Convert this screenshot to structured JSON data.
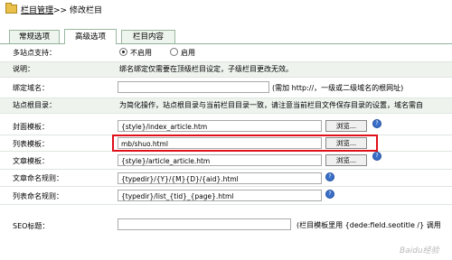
{
  "breadcrumb": {
    "parent": "栏目管理",
    "separator": ">>",
    "current": "修改栏目"
  },
  "tabs": [
    {
      "label": "常规选项"
    },
    {
      "label": "高级选项"
    },
    {
      "label": "栏目内容"
    }
  ],
  "fields": {
    "multisite": {
      "label": "多站点支持：",
      "option_no": "不启用",
      "option_yes": "启用",
      "selected": "不启用"
    },
    "info": {
      "label": "说明：",
      "text": "绑名绑定仅需要在顶级栏目设定，子级栏目更改无效。"
    },
    "domain": {
      "label": "绑定域名：",
      "value": "",
      "note": "(需加 http://，一级或二级域名的根网址)"
    },
    "site_root": {
      "label": "站点根目录：",
      "note": "为简化操作，站点根目录与当前栏目目录一致，请注意当前栏目文件保存目录的设置，域名需自"
    },
    "cover_template": {
      "label": "封面模板：",
      "value": "{style}/index_article.htm",
      "button": "浏览..."
    },
    "list_template": {
      "label": "列表模板：",
      "value": "mb/shuo.html",
      "button": "浏览..."
    },
    "article_template": {
      "label": "文章模板：",
      "value": "{style}/article_article.htm",
      "button": "浏览..."
    },
    "article_naming": {
      "label": "文章命名规则：",
      "value": "{typedir}/{Y}/{M}{D}/{aid}.html"
    },
    "list_naming": {
      "label": "列表命名规则：",
      "value": "{typedir}/list_{tid}_{page}.html"
    },
    "seo_title": {
      "label": "SEO标题：",
      "value": "",
      "note": "(栏目模板里用 {dede:field.seotitle /} 调用"
    }
  },
  "help_icon_glyph": "?",
  "watermark": "Baidu经验"
}
